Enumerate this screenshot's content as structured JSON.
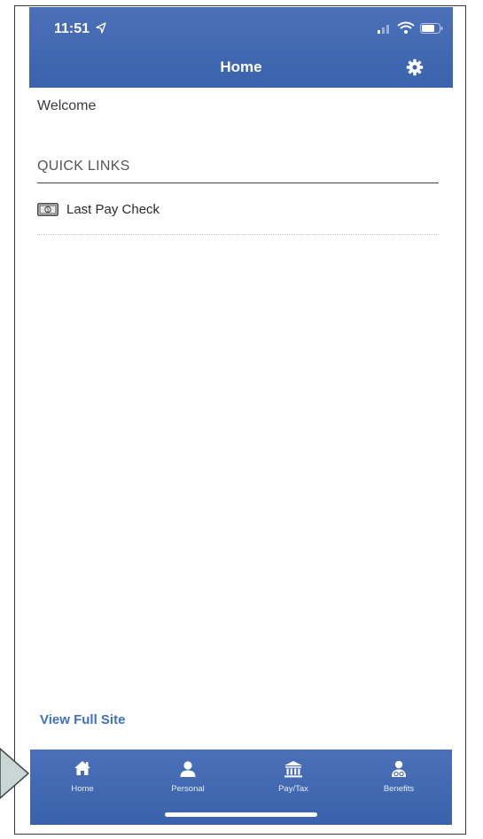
{
  "status_bar": {
    "time": "11:51"
  },
  "header": {
    "title": "Home"
  },
  "welcome": "Welcome",
  "quick_links": {
    "heading": "QUICK LINKS",
    "items": [
      {
        "label": "Last Pay Check",
        "icon": "cash-icon"
      }
    ]
  },
  "footer_link": "View Full Site",
  "tabs": [
    {
      "label": "Home",
      "icon": "home-icon"
    },
    {
      "label": "Personal",
      "icon": "person-icon"
    },
    {
      "label": "Pay/Tax",
      "icon": "bank-icon"
    },
    {
      "label": "Benefits",
      "icon": "benefits-icon"
    }
  ],
  "colors": {
    "primary": "#3d66b0",
    "link": "#3f6fbf"
  }
}
